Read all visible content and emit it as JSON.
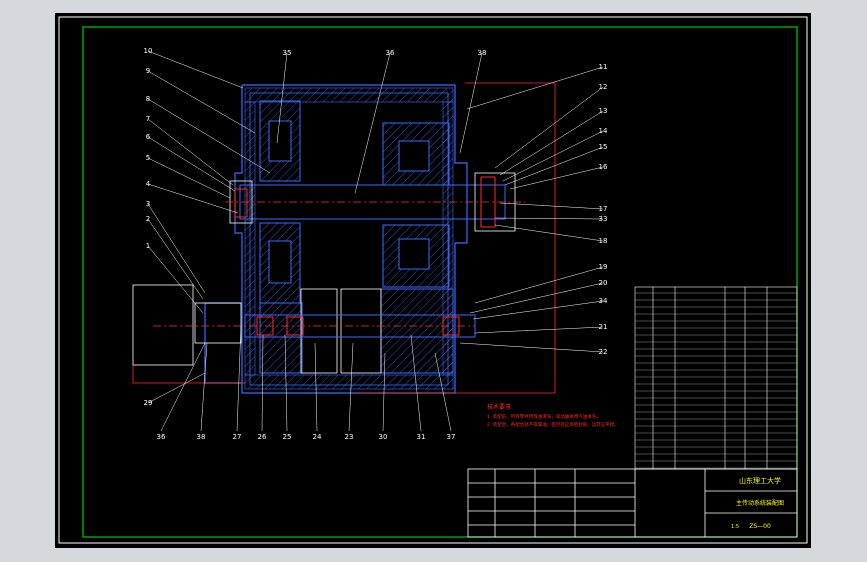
{
  "drawing": {
    "background": "#000000",
    "border_color": "#ffffff",
    "frame_color": "#00cc00",
    "line_color": "#3a6cff",
    "hatch_color": "#3a6cff",
    "center_line_color": "#ff2a2a",
    "leader_color": "#ffffff",
    "title_color": "#ffff00"
  },
  "part_labels": {
    "left_column": [
      "10",
      "9",
      "8",
      "7",
      "6",
      "5",
      "4",
      "3",
      "2",
      "1",
      "29"
    ],
    "top_row": [
      "35",
      "36",
      "38"
    ],
    "right_column": [
      "11",
      "12",
      "13",
      "14",
      "15",
      "16",
      "17",
      "33",
      "18",
      "19",
      "20",
      "34",
      "21",
      "22"
    ],
    "bottom_row": [
      "36",
      "38",
      "27",
      "26",
      "25",
      "24",
      "23",
      "30",
      "31",
      "37"
    ]
  },
  "notes": {
    "header": "技术要求",
    "line1": "1. 装配前，所有零件用煤油清洗，滚动轴承用汽油清洗。",
    "line2": "2. 装配后，各配合处不得漏油，密封处应涂密封胶，运转应平稳。"
  },
  "title_block": {
    "company": "山东理工大学",
    "title": "主传动系统装配图",
    "drawing_no": "ZS—00",
    "scale": "1:5"
  }
}
